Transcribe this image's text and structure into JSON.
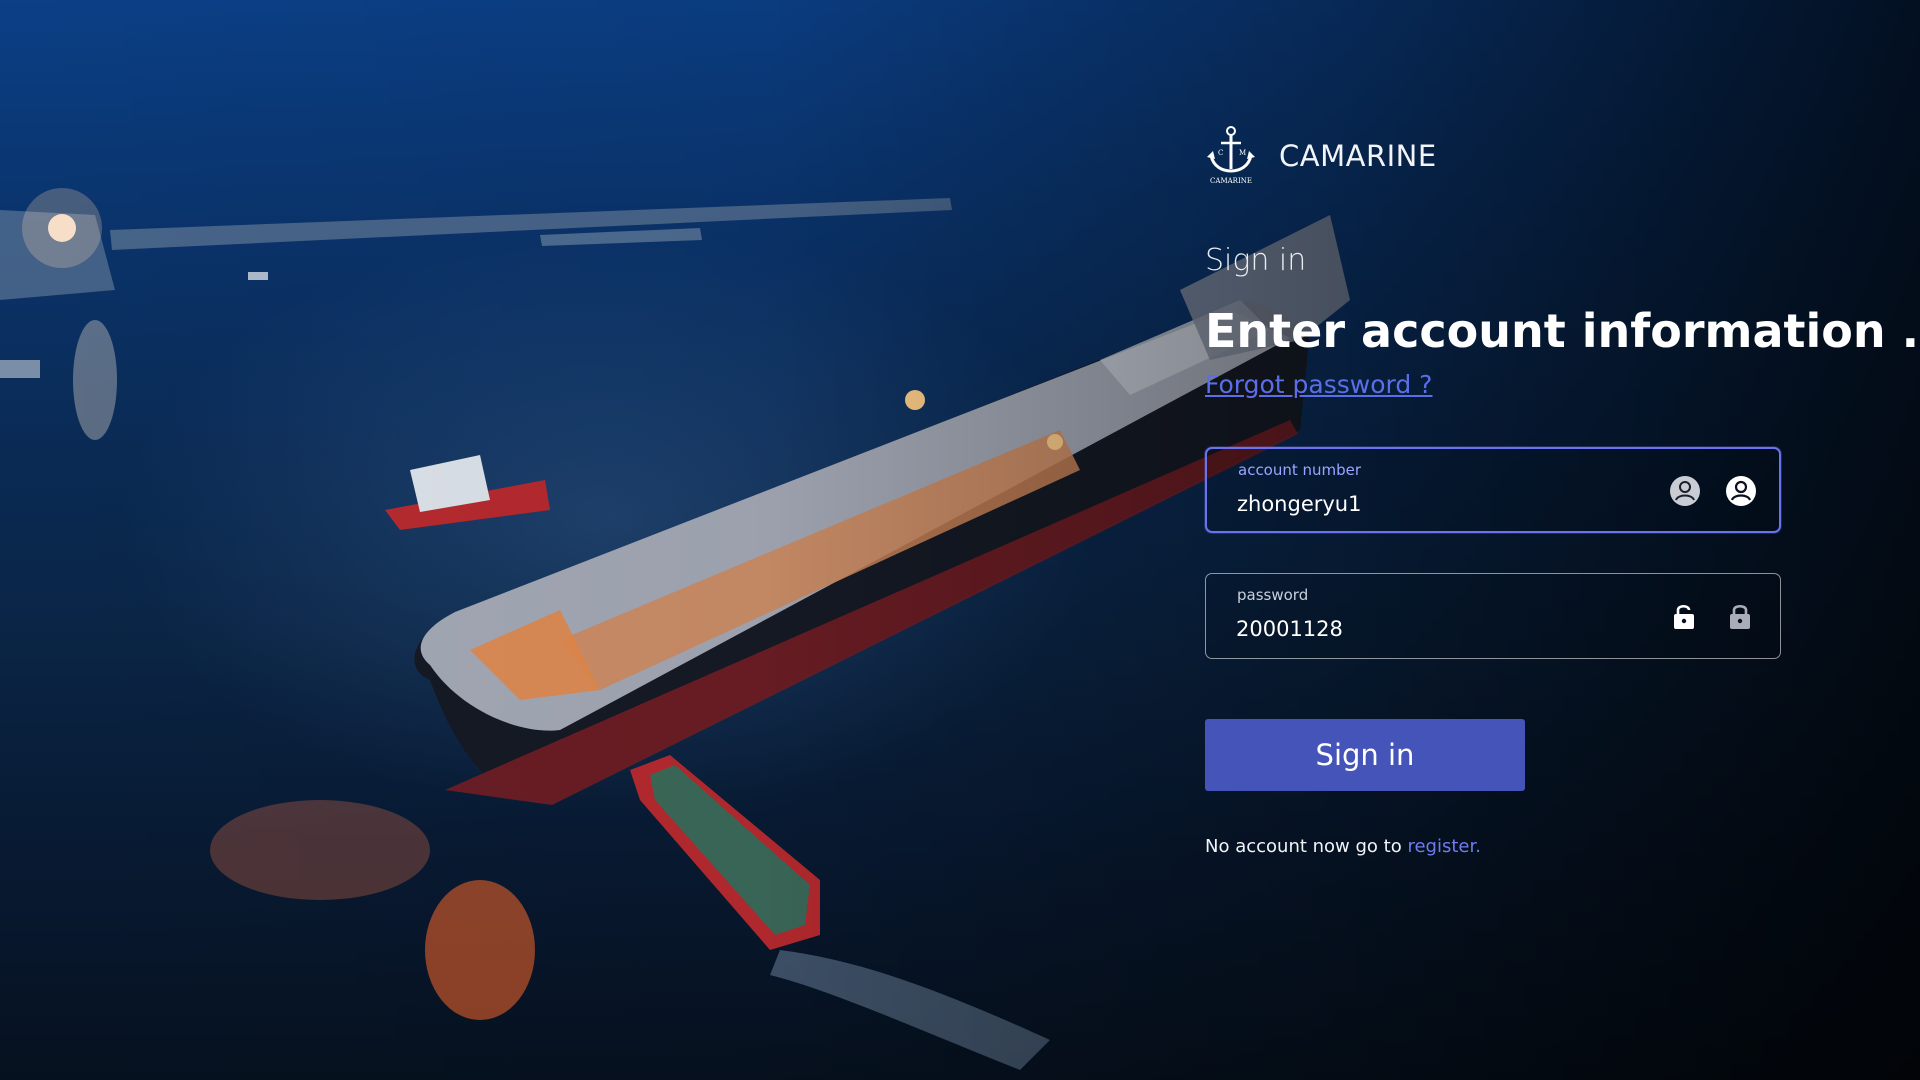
{
  "brand": {
    "name": "CAMARINE",
    "logo_text": "CAMARINE",
    "logo_letters": [
      "C",
      "M"
    ]
  },
  "form": {
    "eyebrow": "Sign in",
    "headline": "Enter account information .",
    "forgot_link": "Forgot password ?",
    "account": {
      "label": "account number",
      "value": "zhongeryu1"
    },
    "password": {
      "label": "password",
      "value": "20001128"
    },
    "submit_label": "Sign in",
    "register_prompt": "No account now go to ",
    "register_link": "register."
  },
  "colors": {
    "accent": "#4454b8",
    "link": "#5b6ee8",
    "focus_border": "#6a72f0"
  },
  "icons": [
    "anchor-icon",
    "user-circle-icon",
    "user-circle-outline-icon",
    "lock-open-icon",
    "lock-closed-icon"
  ]
}
